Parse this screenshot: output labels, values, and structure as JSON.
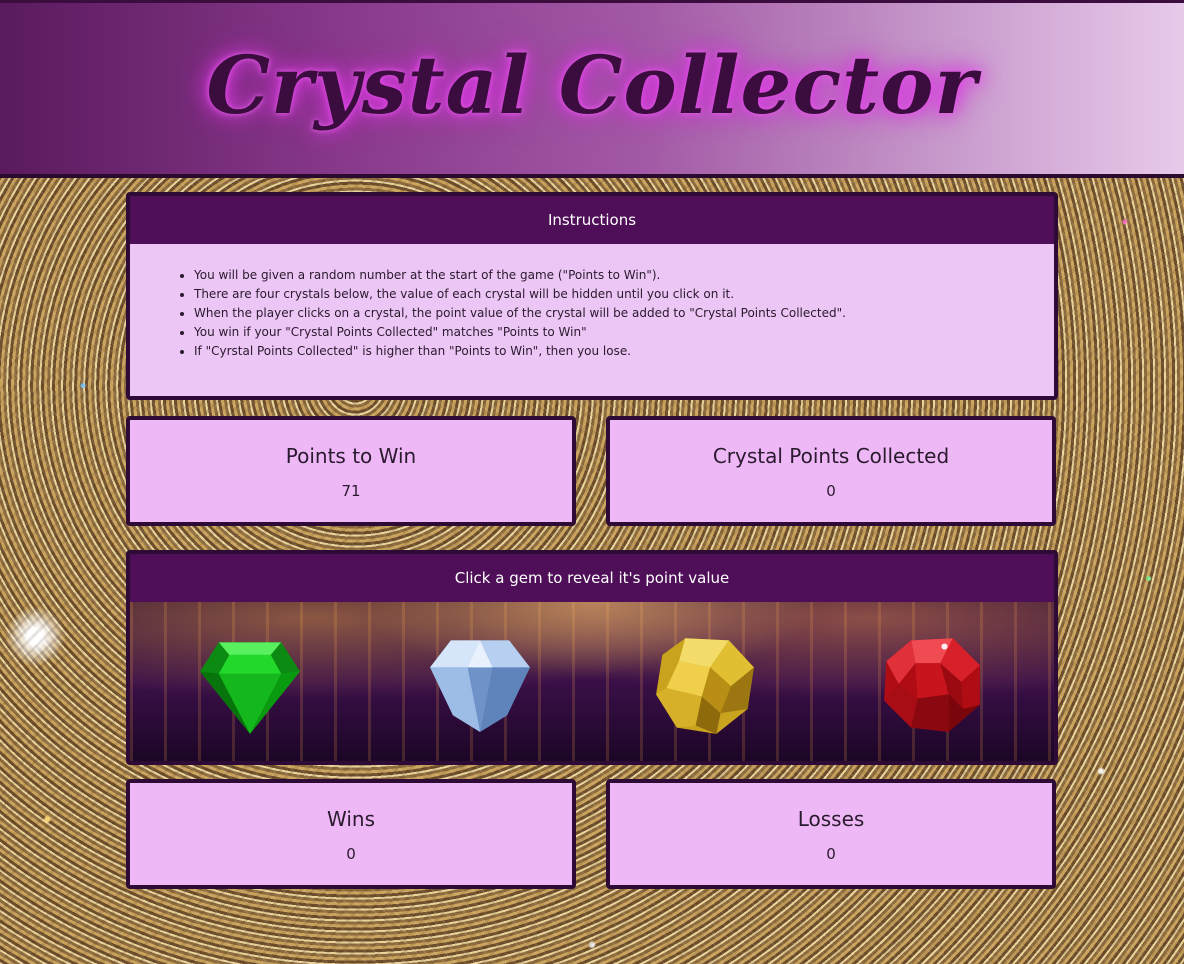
{
  "header": {
    "title": "Crystal Collector"
  },
  "instructions": {
    "heading": "Instructions",
    "items": [
      "You will be given a random number at the start of the game (\"Points to Win\").",
      "There are four crystals below, the value of each crystal will be hidden until you click on it.",
      "When the player clicks on a crystal, the point value of the crystal will be added to \"Crystal Points Collected\".",
      "You win if your \"Crystal Points Collected\" matches \"Points to Win\"",
      "If \"Cyrstal Points Collected\" is higher than \"Points to Win\", then you lose."
    ]
  },
  "scores": {
    "points_to_win": {
      "label": "Points to Win",
      "value": "71"
    },
    "points_collected": {
      "label": "Crystal Points Collected",
      "value": "0"
    },
    "wins": {
      "label": "Wins",
      "value": "0"
    },
    "losses": {
      "label": "Losses",
      "value": "0"
    }
  },
  "gems": {
    "heading": "Click a gem to reveal it's point value",
    "items": [
      {
        "name": "green-gem",
        "color": "#12c81a"
      },
      {
        "name": "blue-gem",
        "color": "#a9c7ee"
      },
      {
        "name": "yellow-gem",
        "color": "#e5c53a"
      },
      {
        "name": "red-gem",
        "color": "#d0141e"
      }
    ]
  }
}
